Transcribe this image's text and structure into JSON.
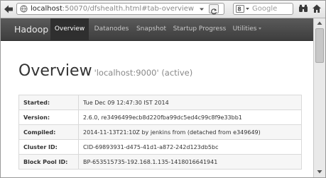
{
  "browser": {
    "url_host": "localhost",
    "url_rest": ":50070/dfshealth.html#tab-overview",
    "search_placeholder": "Google"
  },
  "navbar": {
    "brand": "Hadoop",
    "items": [
      {
        "label": "Overview",
        "active": true
      },
      {
        "label": "Datanodes",
        "active": false
      },
      {
        "label": "Snapshot",
        "active": false
      },
      {
        "label": "Startup Progress",
        "active": false
      },
      {
        "label": "Utilities",
        "active": false,
        "dropdown": true
      }
    ]
  },
  "page": {
    "title": "Overview",
    "subtitle": "'localhost:9000' (active)"
  },
  "info_table": {
    "rows": [
      {
        "key": "Started:",
        "value": "Tue Dec 09 12:47:30 IST 2014"
      },
      {
        "key": "Version:",
        "value": "2.6.0, re3496499ecb8d220fba99dc5ed4c99c8f9e33bb1"
      },
      {
        "key": "Compiled:",
        "value": "2014-11-13T21:10Z by jenkins from (detached from e349649)"
      },
      {
        "key": "Cluster ID:",
        "value": "CID-69893931-d475-41d1-a872-242d123db5bc"
      },
      {
        "key": "Block Pool ID:",
        "value": "BP-653515735-192.168.1.135-1418016641941"
      }
    ]
  },
  "icons": {
    "back": "back-arrow-icon",
    "site": "site-identity-icon",
    "reload": "reload-icon",
    "search_engine": "google-engine-icon",
    "binoculars": "binoculars-icon",
    "home": "home-icon"
  },
  "colors": {
    "navbar": "#444444",
    "navbar_active": "#2f2f2f",
    "table_border": "#d9d9d9"
  }
}
